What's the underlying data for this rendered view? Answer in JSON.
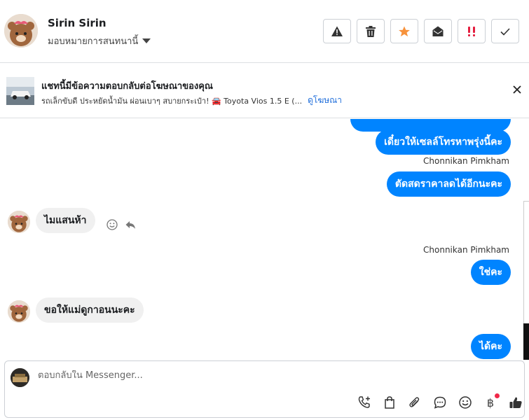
{
  "header": {
    "name": "Sirin Sirin",
    "assign_label": "มอบหมายการสนทนานี้",
    "actions": [
      "warning-icon",
      "trash-icon",
      "star-icon",
      "envelope-open-icon",
      "priority-icon",
      "check-icon"
    ],
    "colors": {
      "star": "#f7923b",
      "priority": "#e41e3f"
    }
  },
  "ad": {
    "title": "แชทนี้มีข้อความตอบกลับต่อโฆษณาของคุณ",
    "subtitle": "รถเล็กขับดี ประหยัดน้ำมัน ผ่อนเบาๆ สบายกระเป๋า! 🚘 Toyota Vios 1.5 E (...",
    "link": "ดูโฆษณา"
  },
  "messages": {
    "out1": "เดี๋ยวให้เซลล์โทรหาพรุ่งนี้คะ",
    "sender1": "Chonnikan Pimkham",
    "out2": "ตัดสดราคาลดได้อีกนะคะ",
    "in1": "ไมแสนห้า",
    "sender2": "Chonnikan Pimkham",
    "out3": "ใช่คะ",
    "in2": "ขอให้แม่ดูกาอนนะคะ",
    "out4": "ได้คะ"
  },
  "composer": {
    "placeholder": "ตอบกลับใน Messenger...",
    "baht": "฿",
    "tools": [
      "phone-plus-icon",
      "shopping-bag-icon",
      "paperclip-icon",
      "chat-bubble-icon",
      "smiley-icon",
      "baht-icon",
      "thumbs-up-icon"
    ],
    "colors": {
      "accent": "#0084ff",
      "badge": "#f02849"
    }
  }
}
